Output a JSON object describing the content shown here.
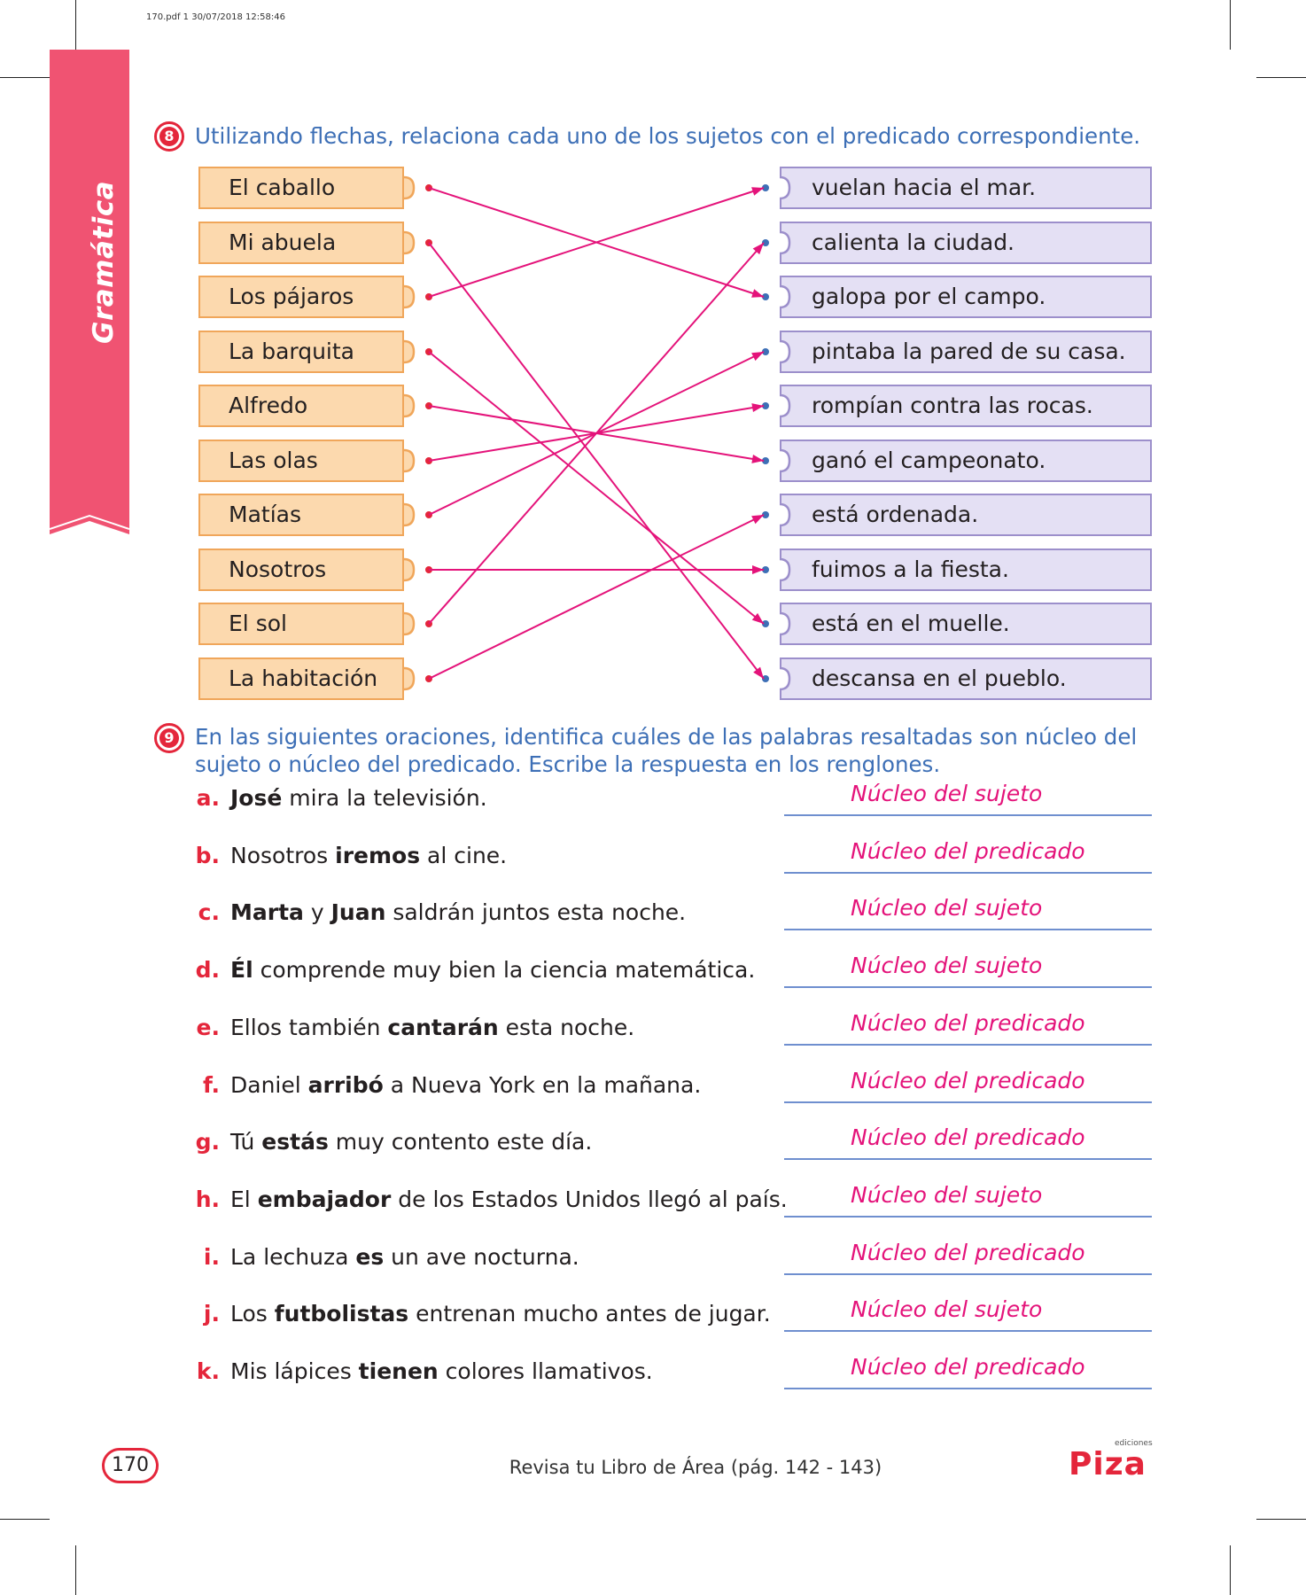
{
  "print_info": "170.pdf   1   30/07/2018   12:58:46",
  "side_tab": "Gramática",
  "colors": {
    "accent_red": "#e4263b",
    "side_tab": "#f05372",
    "arrow": "#e4137a",
    "instruction_blue": "#3d6fb6"
  },
  "ex8": {
    "number": "8",
    "instruction": "Utilizando flechas, relaciona cada uno de los sujetos con el predicado correspondiente.",
    "subjects": [
      "El caballo",
      "Mi abuela",
      "Los pájaros",
      "La barquita",
      "Alfredo",
      "Las olas",
      "Matías",
      "Nosotros",
      "El sol",
      "La habitación"
    ],
    "predicates": [
      "vuelan hacia el mar.",
      "calienta la ciudad.",
      "galopa por el campo.",
      "pintaba la pared de su casa.",
      "rompían contra las rocas.",
      "ganó el campeonato.",
      "está ordenada.",
      "fuimos a la fiesta.",
      "está en el muelle.",
      "descansa en el pueblo."
    ],
    "matches": [
      [
        0,
        2
      ],
      [
        1,
        9
      ],
      [
        2,
        0
      ],
      [
        3,
        8
      ],
      [
        4,
        5
      ],
      [
        5,
        4
      ],
      [
        6,
        3
      ],
      [
        7,
        7
      ],
      [
        8,
        1
      ],
      [
        9,
        6
      ]
    ]
  },
  "ex9": {
    "number": "9",
    "instruction_line1": "En las siguientes oraciones, identifica cuáles de las palabras resaltadas son núcleo del",
    "instruction_line2": "sujeto o núcleo del predicado. Escribe la respuesta en los renglones.",
    "items": [
      {
        "letter": "a.",
        "pre": "",
        "bold": "José",
        "post": " mira la televisión.",
        "answer": "Núcleo del sujeto"
      },
      {
        "letter": "b.",
        "pre": "Nosotros ",
        "bold": "iremos",
        "post": " al cine.",
        "answer": "Núcleo del predicado"
      },
      {
        "letter": "c.",
        "pre": "",
        "bold": "Marta",
        "mid": " y ",
        "bold2": "Juan",
        "post": " saldrán juntos esta noche.",
        "answer": "Núcleo del sujeto"
      },
      {
        "letter": "d.",
        "pre": "",
        "bold": "Él",
        "post": " comprende muy bien la ciencia matemática.",
        "answer": "Núcleo del sujeto"
      },
      {
        "letter": "e.",
        "pre": "Ellos también ",
        "bold": "cantarán",
        "post": " esta noche.",
        "answer": "Núcleo del predicado"
      },
      {
        "letter": "f.",
        "pre": "Daniel ",
        "bold": "arribó",
        "post": " a Nueva York en la mañana.",
        "answer": "Núcleo del predicado"
      },
      {
        "letter": "g.",
        "pre": "Tú ",
        "bold": "estás",
        "post": " muy contento este día.",
        "answer": "Núcleo del predicado"
      },
      {
        "letter": "h.",
        "pre": "El ",
        "bold": "embajador",
        "post": " de los Estados Unidos llegó al país.",
        "answer": "Núcleo del sujeto"
      },
      {
        "letter": "i.",
        "pre": "La lechuza ",
        "bold": "es",
        "post": " un ave nocturna.",
        "answer": "Núcleo del predicado"
      },
      {
        "letter": "j.",
        "pre": "Los ",
        "bold": "futbolistas",
        "post": " entrenan mucho antes de jugar.",
        "answer": "Núcleo del sujeto"
      },
      {
        "letter": "k.",
        "pre": "Mis lápices ",
        "bold": "tienen",
        "post": " colores llamativos.",
        "answer": "Núcleo del predicado"
      }
    ]
  },
  "footer": {
    "page_number": "170",
    "note": "Revisa tu Libro de Área (pág. 142 - 143)",
    "logo_small": "ediciones",
    "logo_big": "Piza"
  }
}
